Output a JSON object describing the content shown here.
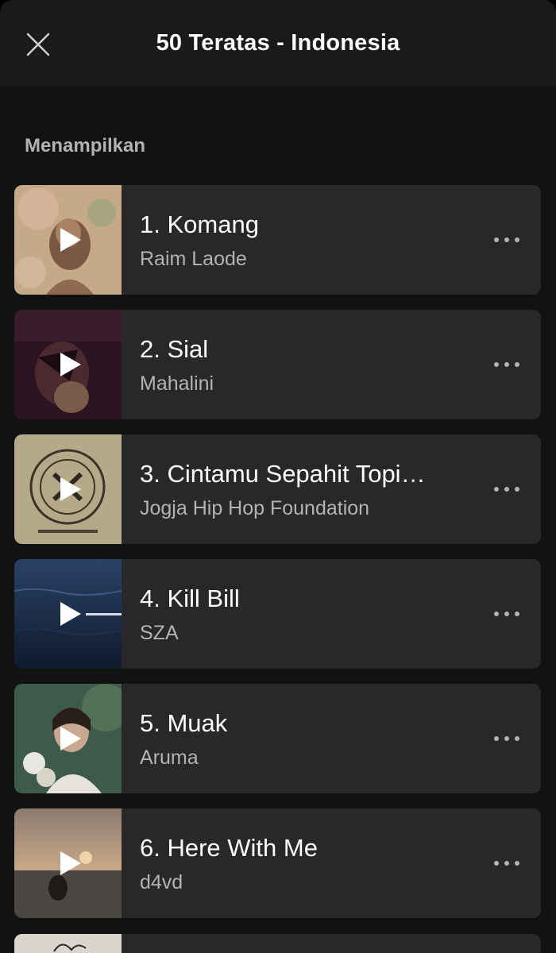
{
  "header": {
    "title": "50 Teratas - Indonesia",
    "close_icon": "close-icon"
  },
  "section": {
    "label": "Menampilkan"
  },
  "tracks": [
    {
      "title": "1. Komang",
      "artist": "Raim Laode",
      "art_color": "#b89a80"
    },
    {
      "title": "2. Sial",
      "artist": "Mahalini",
      "art_color": "#2a1420"
    },
    {
      "title": "3. Cintamu Sepahit Topi…",
      "artist": "Jogja Hip Hop Foundation",
      "art_color": "#b5a98a"
    },
    {
      "title": "4. Kill Bill",
      "artist": "SZA",
      "art_color": "#1e3150"
    },
    {
      "title": "5. Muak",
      "artist": "Aruma",
      "art_color": "#3d5a4a"
    },
    {
      "title": "6. Here With Me",
      "artist": "d4vd",
      "art_color": "#5a4a3e"
    }
  ],
  "icons": {
    "play": "play-icon",
    "more": "more-options-icon"
  },
  "colors": {
    "background": "#121212",
    "header": "#1a1a1a",
    "card": "#282828",
    "secondary_text": "#b3b3b3"
  }
}
